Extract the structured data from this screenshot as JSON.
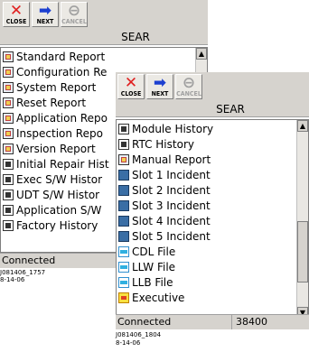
{
  "window_back": {
    "toolbar": {
      "close_label": "CLOSE",
      "next_label": "NEXT",
      "cancel_label": "CANCEL"
    },
    "title": "SEAR",
    "items": [
      {
        "label": "Standard Report",
        "icon": "report-icon"
      },
      {
        "label": "Configuration Re",
        "icon": "report-icon"
      },
      {
        "label": "System Report",
        "icon": "report-icon"
      },
      {
        "label": "Reset Report",
        "icon": "report-icon"
      },
      {
        "label": "Application Repo",
        "icon": "report-icon"
      },
      {
        "label": "Inspection Repo",
        "icon": "report-icon"
      },
      {
        "label": "Version Report",
        "icon": "report-icon"
      },
      {
        "label": "Initial Repair Hist",
        "icon": "history-icon"
      },
      {
        "label": "Exec S/W Histor",
        "icon": "history-icon"
      },
      {
        "label": "UDT S/W Histor",
        "icon": "history-icon"
      },
      {
        "label": "Application S/W",
        "icon": "history-icon"
      },
      {
        "label": "Factory History",
        "icon": "history-icon"
      }
    ],
    "status": "Connected",
    "caption_line1": "J081406_1757",
    "caption_line2": "8-14-06"
  },
  "window_front": {
    "toolbar": {
      "close_label": "CLOSE",
      "next_label": "NEXT",
      "cancel_label": "CANCEL"
    },
    "title": "SEAR",
    "items": [
      {
        "label": "Module History",
        "icon": "history-icon"
      },
      {
        "label": "RTC History",
        "icon": "history-icon"
      },
      {
        "label": "Manual Report",
        "icon": "report-icon"
      },
      {
        "label": "Slot 1 Incident",
        "icon": "incident-icon"
      },
      {
        "label": "Slot 2 Incident",
        "icon": "incident-icon"
      },
      {
        "label": "Slot 3 Incident",
        "icon": "incident-icon"
      },
      {
        "label": "Slot 4 Incident",
        "icon": "incident-icon"
      },
      {
        "label": "Slot 5 Incident",
        "icon": "incident-icon"
      },
      {
        "label": "CDL File",
        "icon": "file-icon"
      },
      {
        "label": "LLW File",
        "icon": "file-icon"
      },
      {
        "label": "LLB File",
        "icon": "file-icon"
      },
      {
        "label": "Executive",
        "icon": "executive-icon"
      }
    ],
    "status": "Connected",
    "status_value": "38400",
    "caption_line1": "J081406_1804",
    "caption_line2": "8-14-06"
  },
  "colors": {
    "close_red": "#e02020",
    "next_blue": "#1c3fd0",
    "disabled_gray": "#a0a0a0",
    "chrome": "#d6d3ce"
  }
}
